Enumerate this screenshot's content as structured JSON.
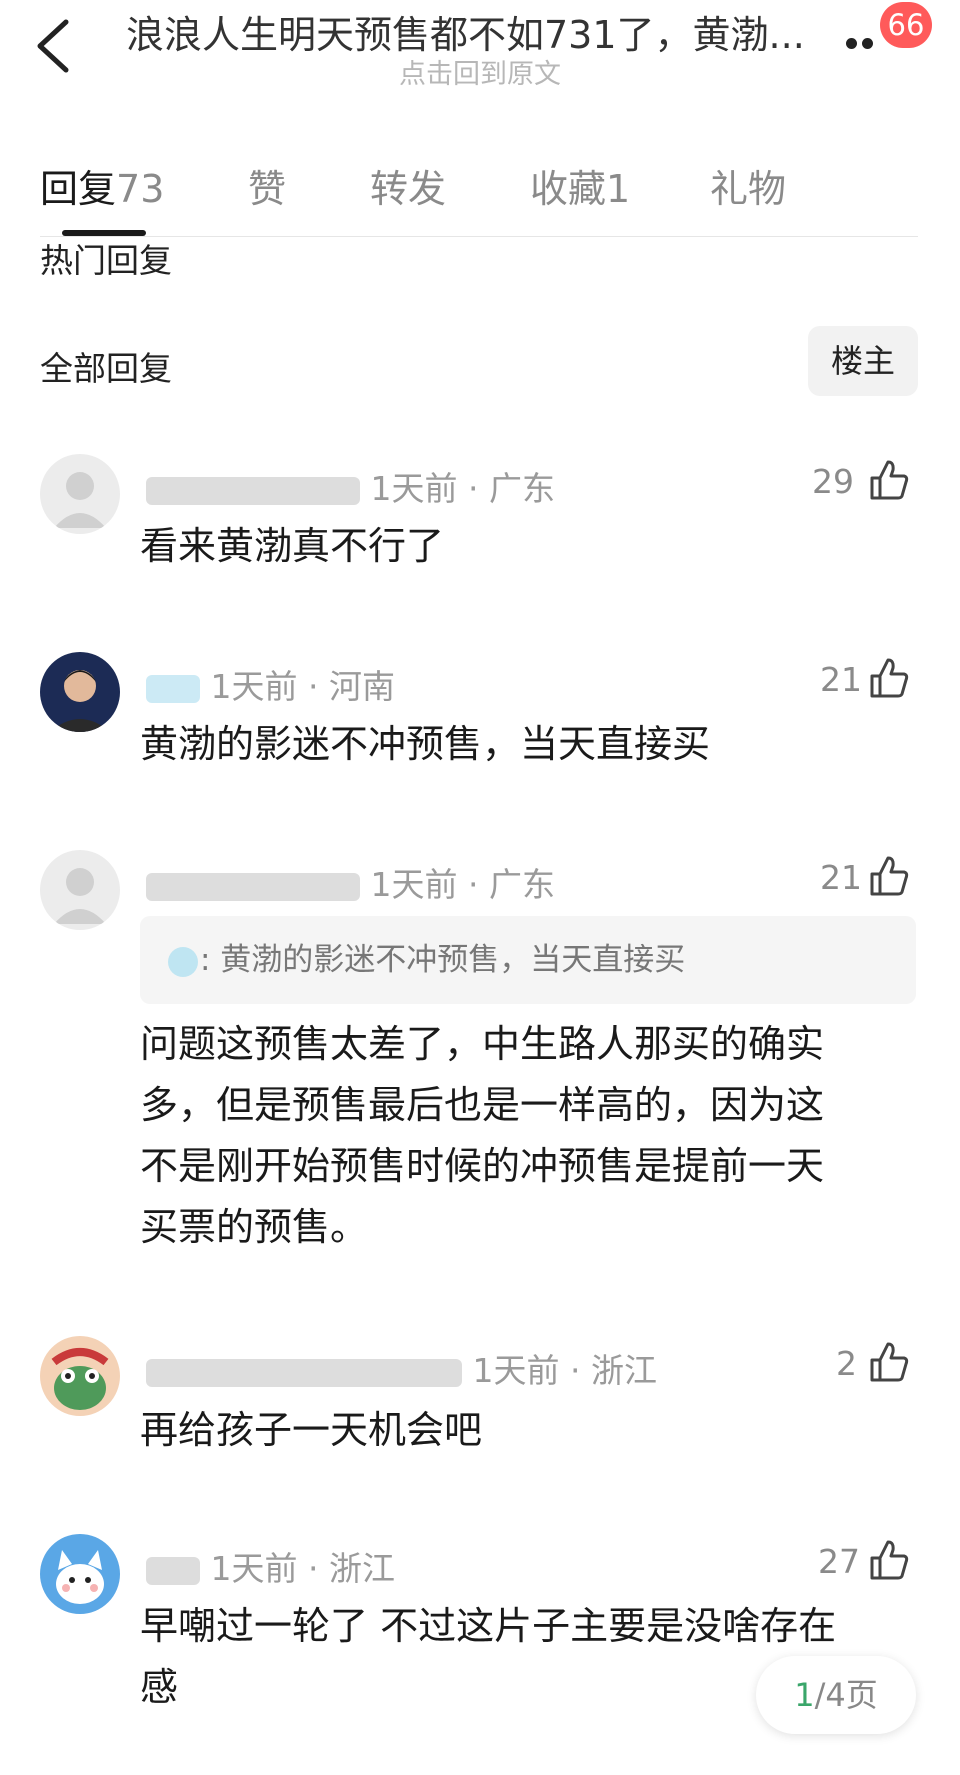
{
  "header": {
    "title": "浪浪人生明天预售都不如731了，黄渤...",
    "subtitle": "点击回到原文",
    "badge": "66"
  },
  "tabs": [
    {
      "label": "回复",
      "count": "73"
    },
    {
      "label": "赞",
      "count": ""
    },
    {
      "label": "转发",
      "count": ""
    },
    {
      "label": "收藏",
      "count": "1"
    },
    {
      "label": "礼物",
      "count": ""
    }
  ],
  "sections": {
    "hot": "热门回复",
    "all": "全部回复",
    "owner_filter": "楼主"
  },
  "comments": [
    {
      "meta": "1天前 · 广东",
      "likes": "29",
      "text": "看来黄渤真不行了"
    },
    {
      "meta": "1天前 · 河南",
      "likes": "21",
      "text": "黄渤的影迷不冲预售，当天直接买"
    },
    {
      "meta": "1天前 · 广东",
      "likes": "21",
      "quote": ": 黄渤的影迷不冲预售，当天直接买",
      "lines": [
        "问题这预售太差了，中生路人那买的确实",
        "多，但是预售最后也是一样高的，因为这",
        "不是刚开始预售时候的冲预售是提前一天",
        "买票的预售。"
      ]
    },
    {
      "meta": "1天前 · 浙江",
      "likes": "2",
      "text": "再给孩子一天机会吧"
    },
    {
      "meta": "1天前 · 浙江",
      "likes": "27",
      "lines": [
        "早嘲过一轮了 不过这片子主要是没啥存在",
        "感"
      ]
    }
  ],
  "pager": {
    "current": "1",
    "total": "/4页"
  },
  "colors": {
    "accent_badge": "#ff5a5a",
    "pager_current": "#3aa66a"
  }
}
